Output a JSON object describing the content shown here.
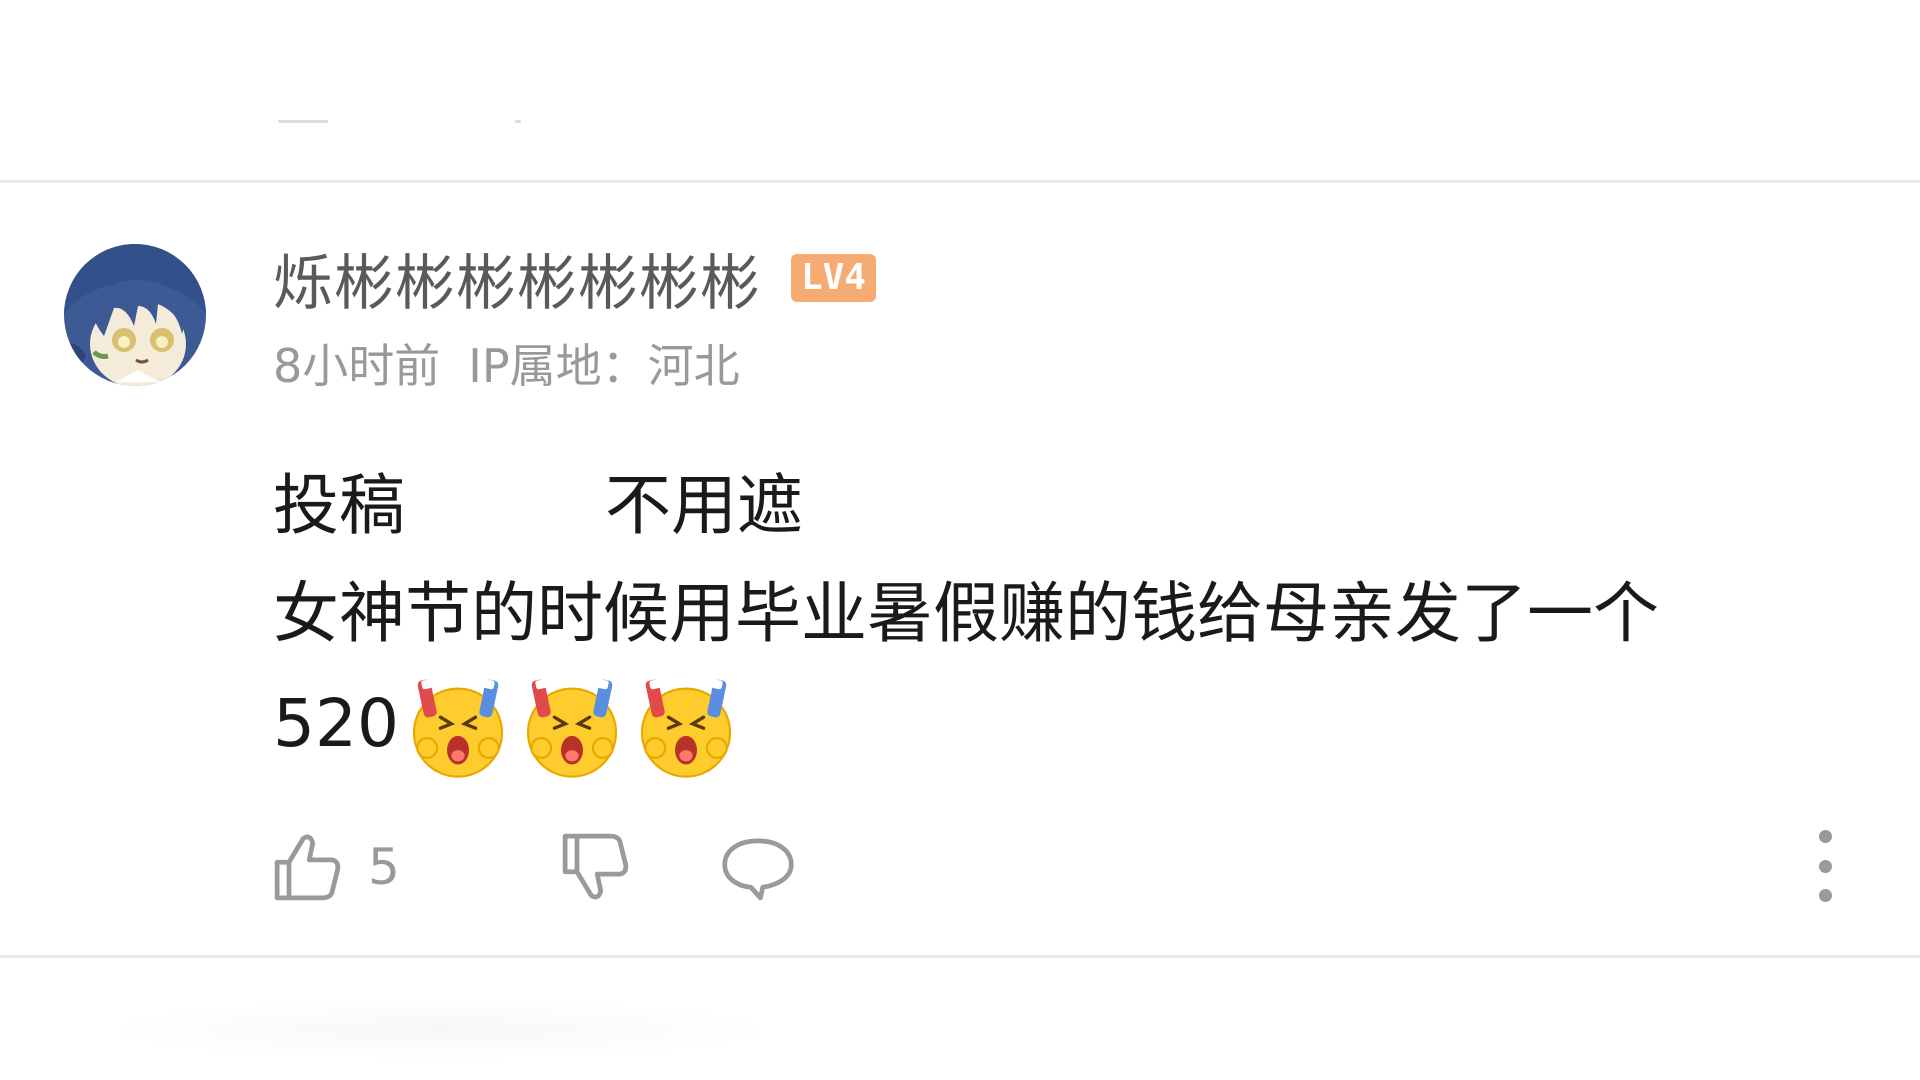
{
  "comment": {
    "username": "烁彬彬彬彬彬彬彬",
    "level_badge": "LV4",
    "time": "8小时前",
    "ip_location": "IP属地：河北",
    "text_line1_a": "投稿",
    "text_line1_b": "不用遮",
    "text_line2": "女神节的时候用毕业暑假赚的钱给母亲发了一个",
    "text_line3": "520",
    "emoji_count": 3,
    "emoji_name": "shocked-emoji"
  },
  "actions": {
    "like_count": "5",
    "like_icon": "thumbs-up-icon",
    "dislike_icon": "thumbs-down-icon",
    "reply_icon": "comment-bubble-icon",
    "more_icon": "more-vertical-icon"
  },
  "colors": {
    "badge": "#f6ab73",
    "meta_text": "#999999",
    "username": "#5a5a5a",
    "body_text": "#1a1a1a",
    "divider": "#ebebeb"
  }
}
